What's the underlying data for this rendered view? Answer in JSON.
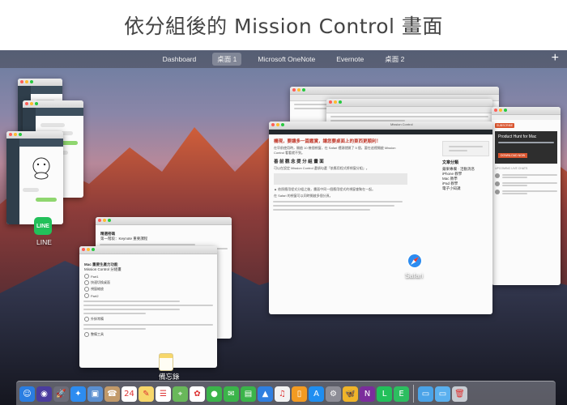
{
  "title": "依分組後的 Mission Control 畫面",
  "spaces": [
    {
      "label": "Dashboard",
      "active": false
    },
    {
      "label": "桌面 1",
      "active": true
    },
    {
      "label": "Microsoft OneNote",
      "active": false
    },
    {
      "label": "Evernote",
      "active": false
    },
    {
      "label": "桌面 2",
      "active": false
    }
  ],
  "add_space_symbol": "+",
  "app_labels": {
    "line": "LINE",
    "safari": "Safari",
    "notes": "備忘錄"
  },
  "browser_main": {
    "tab_text": "Mission Control",
    "article_title": "機現，要讓多一篇鑑賞，讓您要桌面上的東西更順利！",
    "section_heading": "善 前 觀 念 提 分 組 畫 面",
    "para1": "在早前使用時，開啟 10 幾個視窗，在 Safari 裡頭就開了 5 個，要在這裡開啟 Mission Control 看看就不到。",
    "para2": "可以在設定 Mission Control 選項勾選「依應用程式將視窗分組」。",
    "para3": "▲ 依照應用程式分組之後，畫面中同一個應用程式的視窗會聚在一起。",
    "para4": "在 Safari 的視窗可以同時開啟多個分頁。",
    "sidebar_title": "文章分類",
    "sidebar_items": [
      "蘋果專欄 · 活動消息",
      "iPhone 教學",
      "Mac 教學",
      "iPad 教學",
      "電子小知識"
    ]
  },
  "product_hunt": {
    "title": "Product Hunt for Mac",
    "button": "SUBSCRIBE",
    "download": "DOWNLOAD NOW",
    "upcoming": "UPCOMING LIVE CHATS"
  },
  "notes_front": {
    "title": "Mac 重要生產力功能",
    "subtitle": "Mission Control 分組畫",
    "items": [
      "Part1",
      "快速切換桌面",
      "視窗縮放",
      "Part2"
    ],
    "footer_items": [
      "外掛常備",
      "整備工具"
    ]
  },
  "notes_back": {
    "title": "精選密碼",
    "subtitle": "第一階段：Keynote 重要課程"
  },
  "dock_icons": [
    {
      "name": "finder",
      "glyph": "☺",
      "color": "#2a7de1"
    },
    {
      "name": "siri",
      "glyph": "◉",
      "color": "#4b3c9e"
    },
    {
      "name": "launchpad",
      "glyph": "🚀",
      "color": "#6c6c78"
    },
    {
      "name": "safari",
      "glyph": "✦",
      "color": "#2d8cf0"
    },
    {
      "name": "preview",
      "glyph": "▣",
      "color": "#5b8fd0"
    },
    {
      "name": "contacts",
      "glyph": "☎",
      "color": "#c29a6a"
    },
    {
      "name": "calendar",
      "glyph": "24",
      "color": "#ffffff"
    },
    {
      "name": "notes",
      "glyph": "✎",
      "color": "#f7d76b"
    },
    {
      "name": "reminders",
      "glyph": "☰",
      "color": "#ffffff"
    },
    {
      "name": "maps",
      "glyph": "⌖",
      "color": "#69b85a"
    },
    {
      "name": "photos",
      "glyph": "✿",
      "color": "#ffffff"
    },
    {
      "name": "facetime",
      "glyph": "●",
      "color": "#3bb44a"
    },
    {
      "name": "messages",
      "glyph": "✉",
      "color": "#3bb44a"
    },
    {
      "name": "numbers",
      "glyph": "▤",
      "color": "#3bb44a"
    },
    {
      "name": "keynote",
      "glyph": "▲",
      "color": "#2f7fe0"
    },
    {
      "name": "itunes",
      "glyph": "♫",
      "color": "#f2f2f2"
    },
    {
      "name": "ibooks",
      "glyph": "▯",
      "color": "#f39b22"
    },
    {
      "name": "app-store",
      "glyph": "A",
      "color": "#1f8ef1"
    },
    {
      "name": "system-preferences",
      "glyph": "⚙",
      "color": "#8d8d96"
    },
    {
      "name": "tes",
      "glyph": "🦋",
      "color": "#f0b429"
    },
    {
      "name": "onenote",
      "glyph": "N",
      "color": "#7b2d9c"
    },
    {
      "name": "line",
      "glyph": "L",
      "color": "#22c05a"
    },
    {
      "name": "evernote",
      "glyph": "E",
      "color": "#2dbe60"
    },
    {
      "name": "sep",
      "glyph": "",
      "color": ""
    },
    {
      "name": "downloads-folder",
      "glyph": "▭",
      "color": "#4aa3e8"
    },
    {
      "name": "documents-folder",
      "glyph": "▭",
      "color": "#5ab0ef"
    },
    {
      "name": "trash",
      "glyph": "🗑",
      "color": "#c8ccd2"
    }
  ]
}
